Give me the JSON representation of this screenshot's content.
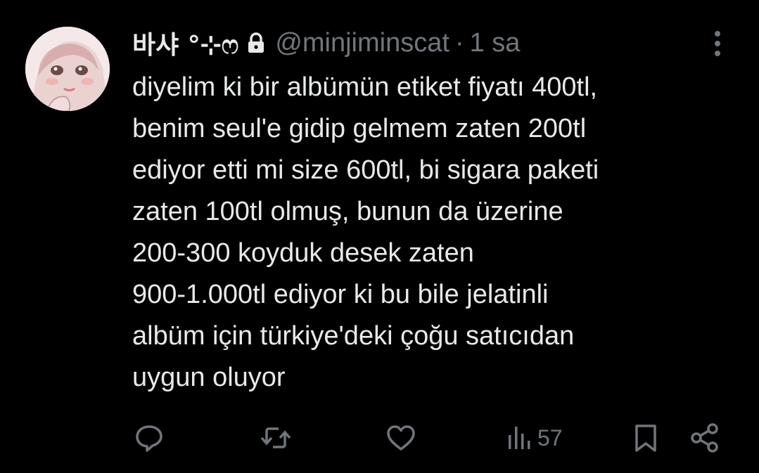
{
  "author": {
    "display_name": "바샤 °⊹ෆ",
    "handle": "@minjiminscat",
    "separator": "·",
    "timestamp": "1 sa",
    "protected_icon": "lock-icon"
  },
  "tweet": {
    "text": "diyelim ki bir albümün etiket fiyatı 400tl,\nbenim seul'e gidip gelmem zaten 200tl\nediyor etti mi size 600tl, bi sigara paketi\nzaten 100tl olmuş, bunun da üzerine\n200-300 koyduk desek zaten\n900-1.000tl ediyor ki bu bile jelatinli\nalbüm için türkiye'deki çoğu satıcıdan\nuygun oluyor"
  },
  "actions": {
    "reply_icon": "reply-icon",
    "retweet_icon": "retweet-icon",
    "like_icon": "heart-icon",
    "views_icon": "views-icon",
    "views_count": "57",
    "bookmark_icon": "bookmark-icon",
    "share_icon": "share-icon"
  },
  "colors": {
    "background": "#000000",
    "primary_text": "#e7e9ea",
    "secondary_text": "#71767b"
  }
}
